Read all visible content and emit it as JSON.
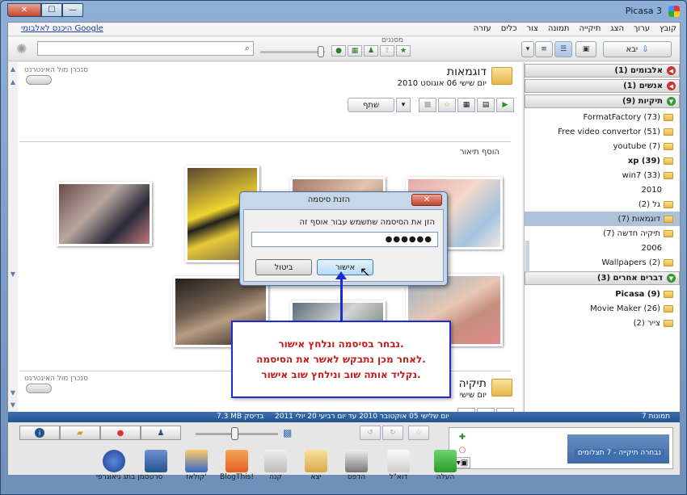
{
  "window": {
    "title": "Picasa 3",
    "close_glyph": "✕",
    "max_glyph": "☐",
    "min_glyph": "—"
  },
  "menu": {
    "items": [
      "קובץ",
      "ערוך",
      "הצג",
      "תיקייה",
      "תמונה",
      "צור",
      "כלים",
      "עזרה"
    ],
    "signin": "היכנס לאלבומי Google"
  },
  "toolbar": {
    "import_label": "יבא",
    "search_placeholder": "",
    "filters_label": "מסננים"
  },
  "left_panel": {
    "albums_header": "אלבומים (1)",
    "people_header": "אנשים (1)",
    "folders_header": "תיקיות (9)",
    "other_header": "דברים אחרים (3)",
    "folders_a": [
      "FormatFactory (73)",
      "Free video convertor (51)",
      "youtube (7)",
      "xp (39)",
      "win7 (33)"
    ],
    "year1": "2010",
    "folders_b": [
      "גל (2)",
      "דוגמאות (7)",
      "תיקיה חדשה (7)"
    ],
    "year2": "2006",
    "folders_c": [
      "Wallpapers (2)"
    ],
    "other": [
      "Picasa (9)",
      "Movie Maker (26)",
      "צייר (2)"
    ]
  },
  "album": {
    "title": "דוגמאות",
    "date": "יום שישי 06 אוגוסט 2010",
    "share_label": "שתף",
    "add_desc": "הוסף תיאור",
    "sync_label": "סנכרן מול האינטרנט"
  },
  "album2": {
    "title": "תיקיה",
    "date": "יום שישי",
    "sync_label": "סנכרן מול האינטרנט",
    "add_desc": "הוסף תיאור"
  },
  "status": {
    "count": "7 תמונות",
    "range": "יום שלישי 05 אוקטובר 2010 עד יום רביעי 20 יולי 2011",
    "size": "7.3 MB בדיסק"
  },
  "tray": {
    "label": "נבחרה תיקייה - 7 תצלומים"
  },
  "tools": [
    "העלה",
    "דוא\"ל",
    "הדפס",
    "יצא",
    "קנה",
    "BlogThis!",
    "קולאז'",
    "סרט",
    "סמן בתג גיאוגרפי"
  ],
  "dialog": {
    "title": "הזנת סיסמה",
    "close_glyph": "✕",
    "prompt": "הזן את הסיסמה שתשמש עבור אוסף זה",
    "password": "●●●●●●",
    "ok": "אישור",
    "cancel": "ביטול"
  },
  "callout": {
    "line1": "נבחר בסיסמה ונלחץ אישור.",
    "line2": "לאחר מכן נתבקש לאשר את הסיסמה.",
    "line3": "נקליד אותה שוב ונילחץ שוב אישור."
  },
  "colors": {
    "accent": "#1d2bd0",
    "callout_text": "#c41a1a",
    "status_bar": "#2b5d9a"
  }
}
